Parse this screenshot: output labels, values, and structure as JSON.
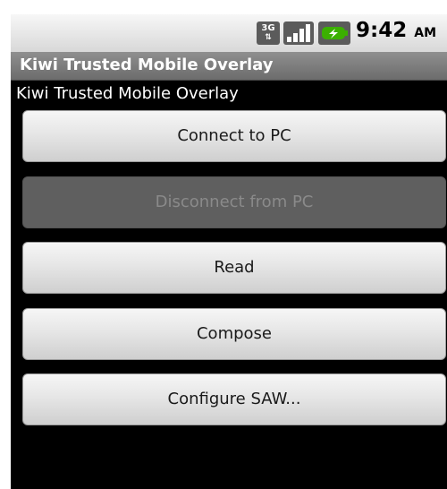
{
  "status_bar": {
    "network_badge": "3G",
    "time": "9:42",
    "ampm": "AM",
    "icons": [
      "network-3g-icon",
      "signal-icon",
      "battery-charging-icon"
    ]
  },
  "window": {
    "title": "Kiwi Trusted Mobile Overlay"
  },
  "main": {
    "label": "Kiwi Trusted Mobile Overlay",
    "buttons": [
      {
        "label": "Connect to PC",
        "enabled": true
      },
      {
        "label": "Disconnect from PC",
        "enabled": false
      },
      {
        "label": "Read",
        "enabled": true
      },
      {
        "label": "Compose",
        "enabled": true
      },
      {
        "label": "Configure SAW...",
        "enabled": true
      }
    ]
  },
  "colors": {
    "title_bar": "#7d7d7d",
    "button_enabled": "#e6e6e6",
    "button_disabled": "#5f5f5f",
    "battery_green": "#3bb000"
  }
}
